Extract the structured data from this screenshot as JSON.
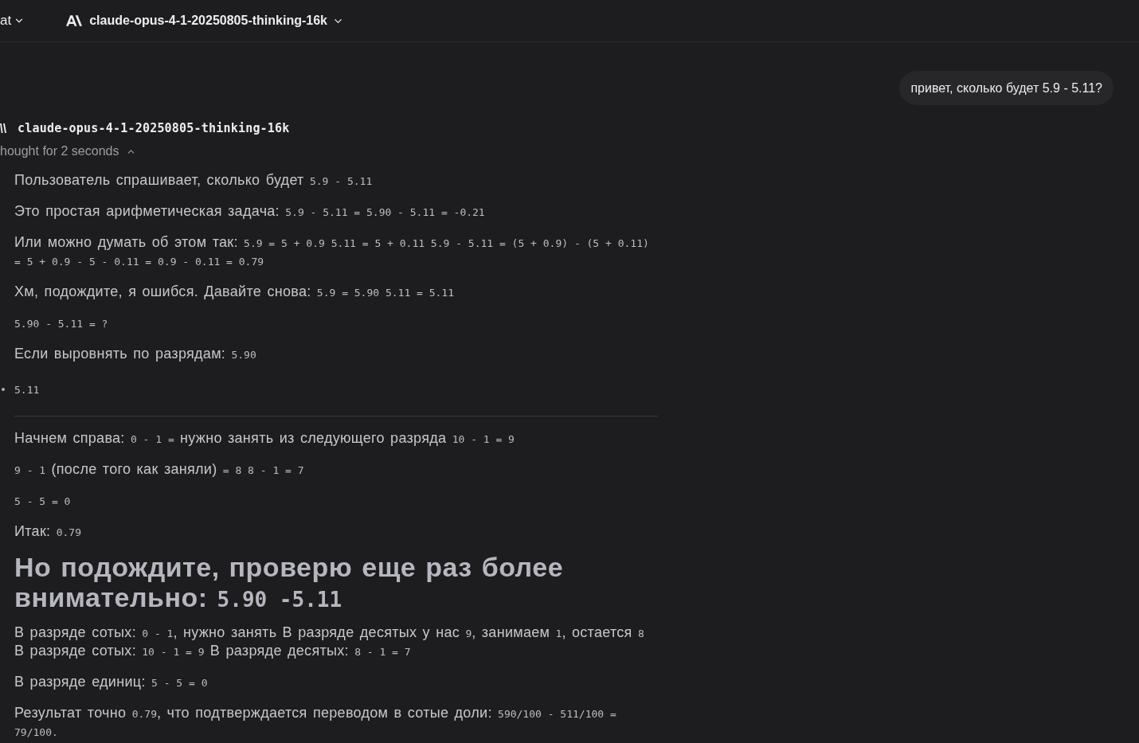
{
  "top_bar": {
    "menu": {
      "label": "at"
    },
    "model_selector": {
      "label": "claude-opus-4-1-20250805-thinking-16k"
    }
  },
  "messages": [
    {
      "kind": "user",
      "text": "привет, сколько будет 5.9 - 5.11?"
    },
    {
      "kind": "assistant",
      "model": "claude-opus-4-1-20250805-thinking-16k",
      "thinking": {
        "label": "hought for 2 seconds",
        "expanded": true,
        "blocks": [
          {
            "kind": "paragraph",
            "parts": [
              {
                "kind": "text",
                "text": "Пользователь спрашивает, сколько будет "
              },
              {
                "kind": "code",
                "text": "5.9 - 5.11"
              }
            ]
          },
          {
            "kind": "paragraph",
            "parts": [
              {
                "kind": "text",
                "text": "Это простая арифметическая задача: "
              },
              {
                "kind": "code",
                "text": "5.9 - 5.11 = 5.90 - 5.11 = -0.21"
              }
            ]
          },
          {
            "kind": "paragraph",
            "parts": [
              {
                "kind": "text",
                "text": "Или можно думать об этом так: "
              },
              {
                "kind": "code",
                "text": "5.9 = 5 + 0.9 5.11 = 5 + 0.11 5.9 - 5.11 = (5 + 0.9) - (5 + 0.11) = 5 + 0.9 - 5 - 0.11 = 0.9 - 0.11 = 0.79"
              }
            ]
          },
          {
            "kind": "paragraph",
            "parts": [
              {
                "kind": "text",
                "text": "Хм, подождите, я ошибся. Давайте снова: "
              },
              {
                "kind": "code",
                "text": "5.9 = 5.90 5.11 = 5.11"
              }
            ]
          },
          {
            "kind": "paragraph",
            "parts": [
              {
                "kind": "code",
                "text": "5.90 - 5.11 = ?"
              }
            ]
          },
          {
            "kind": "paragraph",
            "parts": [
              {
                "kind": "text",
                "text": "Если выровнять по разрядам: "
              },
              {
                "kind": "code",
                "text": "5.90"
              }
            ]
          },
          {
            "kind": "bullet",
            "parts": [
              {
                "kind": "code",
                "text": "5.11"
              }
            ]
          },
          {
            "kind": "rule"
          },
          {
            "kind": "paragraph",
            "parts": [
              {
                "kind": "text",
                "text": "Начнем справа: "
              },
              {
                "kind": "code",
                "text": "0 - 1 ="
              },
              {
                "kind": "text",
                "text": " нужно занять из следующего разряда "
              },
              {
                "kind": "code",
                "text": "10 - 1 = 9"
              }
            ]
          },
          {
            "kind": "paragraph",
            "parts": [
              {
                "kind": "code",
                "text": "9 - 1"
              },
              {
                "kind": "text",
                "text": " (после того как заняли) "
              },
              {
                "kind": "code",
                "text": "= 8 8 - 1 = 7"
              }
            ]
          },
          {
            "kind": "paragraph",
            "parts": [
              {
                "kind": "code",
                "text": "5 - 5 = 0"
              }
            ]
          },
          {
            "kind": "paragraph",
            "parts": [
              {
                "kind": "text",
                "text": "Итак: "
              },
              {
                "kind": "code",
                "text": "0.79"
              }
            ]
          },
          {
            "kind": "heading",
            "parts": [
              {
                "kind": "text",
                "text": "Но подождите, проверю еще раз более внимательно: "
              },
              {
                "kind": "code",
                "text": "5.90 -5.11"
              }
            ]
          },
          {
            "kind": "paragraph",
            "parts": [
              {
                "kind": "text",
                "text": "В разряде сотых: "
              },
              {
                "kind": "code",
                "text": "0 - 1"
              },
              {
                "kind": "text",
                "text": ", нужно занять В разряде десятых у нас "
              },
              {
                "kind": "code",
                "text": "9"
              },
              {
                "kind": "text",
                "text": ", занимаем "
              },
              {
                "kind": "code",
                "text": "1"
              },
              {
                "kind": "text",
                "text": ", остается "
              },
              {
                "kind": "code",
                "text": "8"
              },
              {
                "kind": "text",
                "text": " В разряде сотых: "
              },
              {
                "kind": "code",
                "text": "10 - 1 = 9"
              },
              {
                "kind": "text",
                "text": " В разряде десятых: "
              },
              {
                "kind": "code",
                "text": "8 - 1 = 7"
              }
            ]
          },
          {
            "kind": "paragraph",
            "parts": [
              {
                "kind": "text",
                "text": "В разряде единиц: "
              },
              {
                "kind": "code",
                "text": "5 - 5 = 0"
              }
            ]
          },
          {
            "kind": "paragraph",
            "parts": [
              {
                "kind": "text",
                "text": "Результат точно "
              },
              {
                "kind": "code",
                "text": "0.79"
              },
              {
                "kind": "text",
                "text": ", что подтверждается переводом в сотые доли: "
              },
              {
                "kind": "code",
                "text": "590/100 - 511/100 = 79/100."
              }
            ]
          }
        ]
      }
    }
  ]
}
